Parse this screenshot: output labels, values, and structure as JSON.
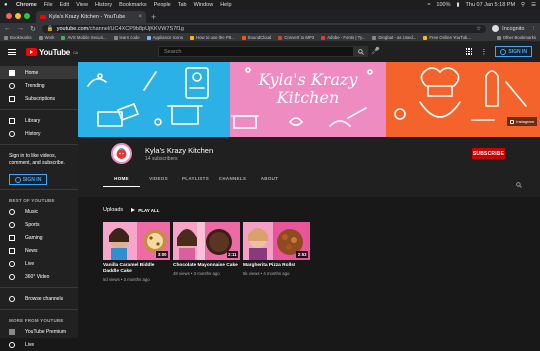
{
  "os_menubar": {
    "app": "Chrome",
    "items": [
      "File",
      "Edit",
      "View",
      "History",
      "Bookmarks",
      "People",
      "Tab",
      "Window",
      "Help"
    ],
    "battery": "100%",
    "clock": "Thu 07 Jan  5:18 PM"
  },
  "browser": {
    "tab_title": "Kyla's Krazy Kitchen - YouTube",
    "url_domain": "youtube.com",
    "url_path": "/channel/UC4XCP9b8pUjKKVW7S7f1g",
    "profile_label": "Incognito",
    "bookmarks": [
      "Bookmarks",
      "Work",
      "AVS Mobile Securi...",
      "learn code",
      "Appliance Icons",
      "How to use the P8...",
      "SoundCloud",
      "Convert to MP3",
      "Adobe - Fonts | Ty...",
      "Dingbat - as Used...",
      "Free Online YouTub..."
    ],
    "other_bookmarks": "Other Bookmarks"
  },
  "youtube": {
    "logo_text": "YouTube",
    "logo_region": "CA",
    "search_placeholder": "Search",
    "sign_in": "SIGN IN"
  },
  "sidebar": {
    "main": [
      "Home",
      "Trending",
      "Subscriptions"
    ],
    "library": [
      "Library",
      "History"
    ],
    "signin_prompt": "Sign in to like videos, comment, and subscribe.",
    "signin_button": "SIGN IN",
    "best_header": "BEST OF YOUTUBE",
    "best": [
      "Music",
      "Sports",
      "Gaming",
      "News",
      "Live",
      "360° Video"
    ],
    "browse": "Browse channels",
    "more_header": "MORE FROM YOUTUBE",
    "more": [
      "YouTube Premium",
      "Live"
    ]
  },
  "channel": {
    "banner_title_line1": "Kyla's Krazy",
    "banner_title_line2": "Kitchen",
    "banner_link": "Instagram",
    "name": "Kyla's Krazy Kitchen",
    "subscribers": "14 subscribers",
    "subscribe": "SUBSCRIBE",
    "tabs": [
      "HOME",
      "VIDEOS",
      "PLAYLISTS",
      "CHANNELS",
      "ABOUT"
    ],
    "active_tab": "HOME"
  },
  "uploads": {
    "heading": "Uploads",
    "play_all": "PLAY ALL",
    "videos": [
      {
        "title": "Vanilla Caramel Biddle Daddle Cake",
        "meta": "5d views • 3 months ago",
        "duration": "3:00"
      },
      {
        "title": "Chocolate Mayonnaise Cake",
        "meta": "48 views • 3 months ago",
        "duration": "2:11"
      },
      {
        "title": "Margherita Pizza Rolls!",
        "meta": "5k views • 4 months ago",
        "duration": "2:53"
      }
    ]
  },
  "colors": {
    "banner_blue": "#2bb1e5",
    "banner_pink": "#ee8bc0",
    "banner_orange": "#f3632b",
    "subscribe_red": "#cc0000",
    "link_blue": "#3ea6ff"
  }
}
